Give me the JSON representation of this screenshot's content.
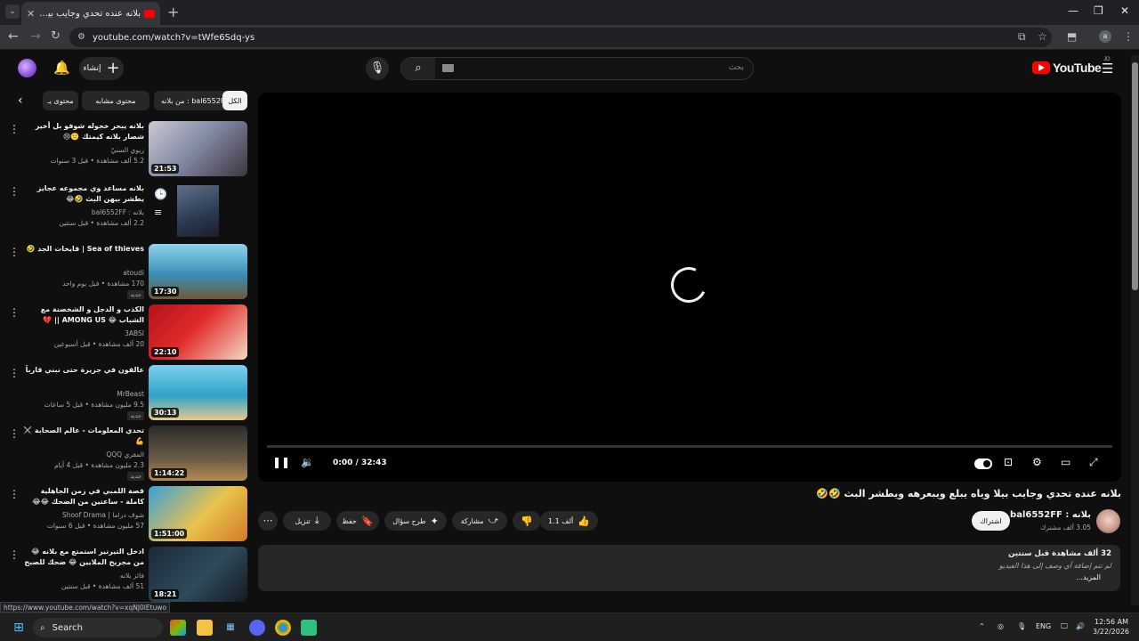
{
  "browser": {
    "tab_title": "بلانه عنده تحدي وجايب بيلا وياه ي",
    "address": "youtube.com/watch?v=tWfe6Sdq-ys",
    "profile_initial": "a",
    "status_url": "https://www.youtube.com/watch?v=xqNJ0lEtuwo"
  },
  "masthead": {
    "create_label": "إنشاء",
    "search_placeholder": "بحث",
    "logo_text": "YouTube",
    "logo_region": "JO"
  },
  "chips": [
    "الكل",
    "من بلانه : bal6552FF",
    "محتوى مشابه",
    "محتوى يـ"
  ],
  "recommendations": [
    {
      "title": "بلانه يبحر خجوله شوفو بل أخير شصار بلانه كيمتك 🙁😢",
      "channel": "زيوي السنيّ",
      "meta": "5.2 ألف مشاهدة • قبل 3 سنوات",
      "duration": "21:53",
      "badge": ""
    },
    {
      "title": "بلانه مساعد وي مجموعه عجايز يطشر بيهن البث 🤣😂",
      "channel": "بلانه : bal6552FF",
      "meta": "2.2 ألف مشاهدة • قبل سنتين",
      "duration": "",
      "badge": ""
    },
    {
      "title": "Sea of thieves | قايخات الجد 🤣",
      "channel": "atoudi",
      "meta": "170 مشاهدة • قبل يوم واحد",
      "duration": "17:30",
      "badge": "جديد"
    },
    {
      "title": "الكذب و الدجل و الشخصنة مع الشباب 😂 AMONG US || 💔",
      "channel": "3ABSI",
      "meta": "20 ألف مشاهدة • قبل أسبوعين",
      "duration": "22:10",
      "badge": ""
    },
    {
      "title": "عالقون في جزيرة حتى نبني قارباً",
      "channel": "MrBeast",
      "meta": "9.5 مليون مشاهدة • قبل 5 ساعات",
      "duration": "30:13",
      "badge": "جديد"
    },
    {
      "title": "تحدي المعلومات - عالم الصحابة ⚔️ 💪",
      "channel": "المقري QQQ",
      "meta": "2.3 مليون مشاهدة • قبل 4 أيام",
      "duration": "1:14:22",
      "badge": "جديد"
    },
    {
      "title": "قصة اللمبي في زمن الجاهلية كاملة - ساعتين من الضحك 😂😂 محمد سعد - فيلم اطلط",
      "channel": "شوف دراما | Shoof Drama",
      "meta": "57 مليون مشاهدة • قبل 6 سنوات",
      "duration": "1:51:00",
      "badge": ""
    },
    {
      "title": "ادخل التيرنير استمتع مع بلانه 😂 من مجريح الملايين 😂 ضحك للصبح",
      "channel": "فائز بلانه",
      "meta": "51 ألف مشاهدة • قبل سنتين",
      "duration": "18:21",
      "badge": ""
    }
  ],
  "player": {
    "time": "0:00 / 32:43",
    "progress": 0
  },
  "video": {
    "title": "بلانه عنده تحدي وجايب بيلا وياه يبلع ويبعرهه ويطشر البث 🤣🤣",
    "channel_name": "بلانه : bal6552FF",
    "subscribers": "3.05 ألف مشترك",
    "subscribe_label": "اشتراك",
    "like_count": "1.1 ألف",
    "share_label": "مشاركة",
    "ask_label": "طرح سؤال",
    "save_label": "حفظ",
    "download_label": "تنزيل",
    "stats": "32 ألف مشاهدة  قبل سنتين",
    "description": "لم تتم إضافة أي وصف إلى هذا الفيديو",
    "more_label": "...المزيد"
  },
  "taskbar": {
    "search_label": "Search",
    "language": "ENG",
    "time": "12:56 AM",
    "date": "3/22/2026"
  }
}
